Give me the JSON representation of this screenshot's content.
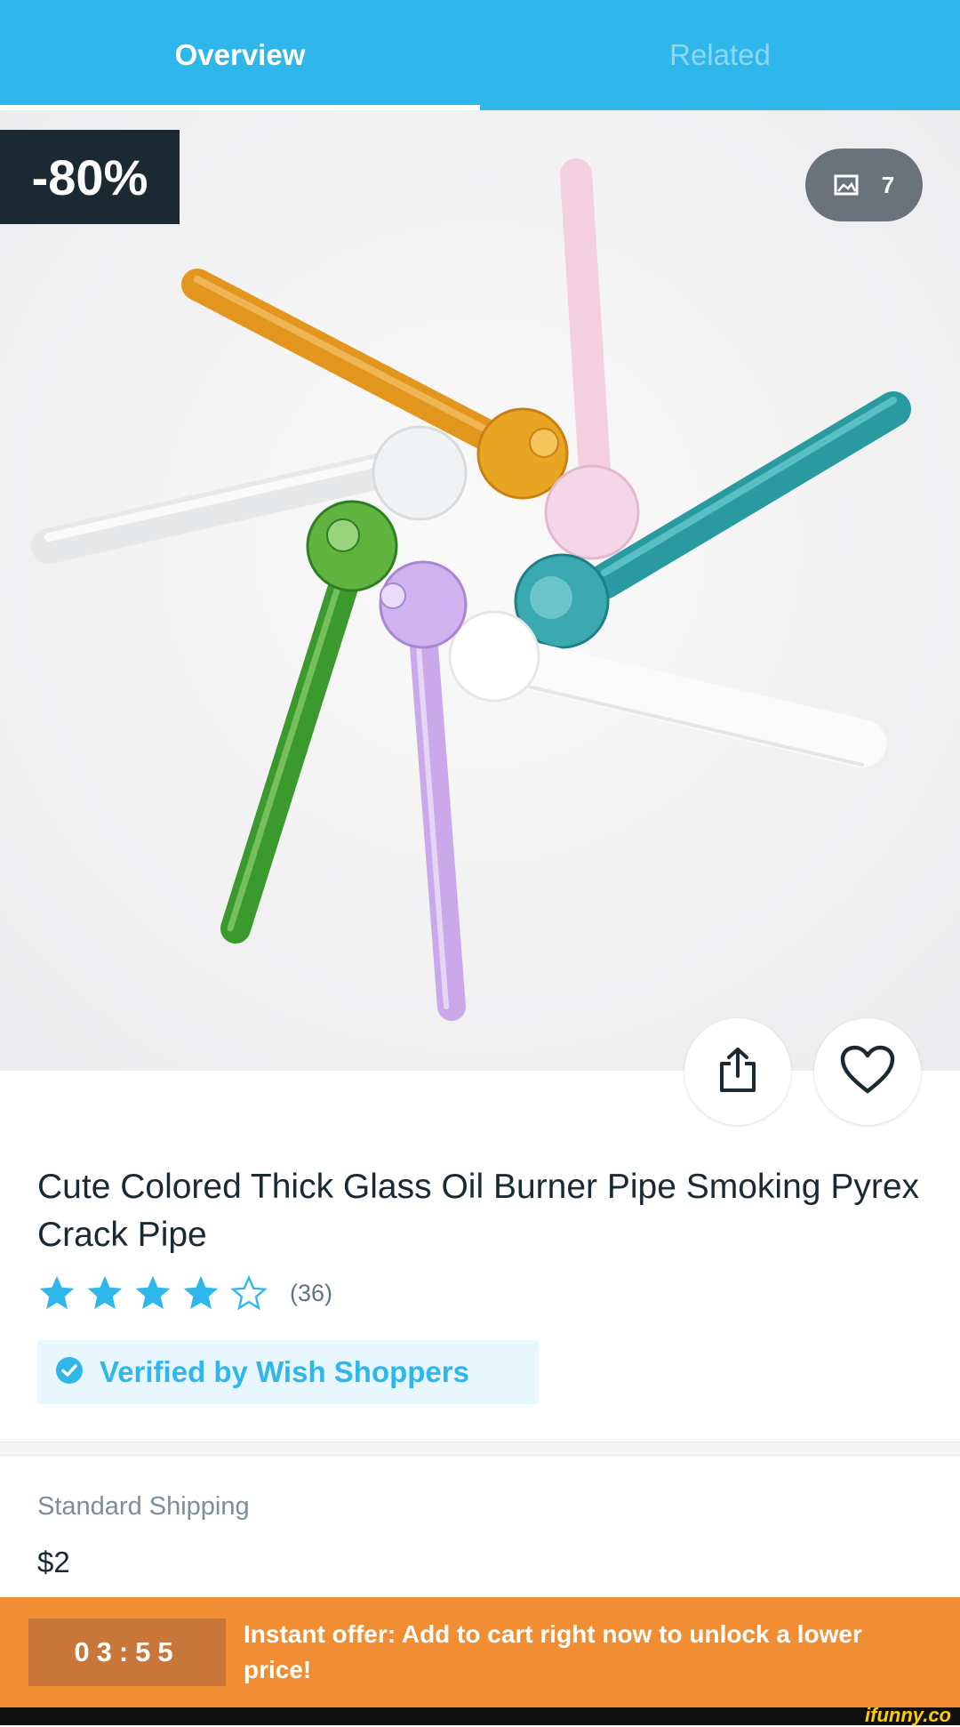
{
  "tabs": [
    {
      "label": "Overview",
      "active": true
    },
    {
      "label": "Related",
      "active": false
    }
  ],
  "product": {
    "discount_badge": "-80%",
    "image_count": "7",
    "title": "Cute Colored Thick Glass Oil Burner Pipe Smoking Pyrex Crack Pipe",
    "rating": {
      "stars_filled": 4,
      "stars_total": 5,
      "count_label": "(36)"
    },
    "verified_label": "Verified by Wish Shoppers"
  },
  "shipping": {
    "label": "Standard Shipping",
    "price": "$2"
  },
  "offer": {
    "timer": "03:55",
    "text": "Instant offer: Add to cart right now to unlock a lower price!"
  },
  "watermark": "ifunny.co",
  "colors": {
    "brand_blue": "#2fb7ec",
    "offer_orange": "#f18e33",
    "badge_dark": "#1b2933"
  },
  "icons": [
    "gallery-icon",
    "share-icon",
    "heart-icon",
    "star-icon",
    "check-circle-icon"
  ]
}
